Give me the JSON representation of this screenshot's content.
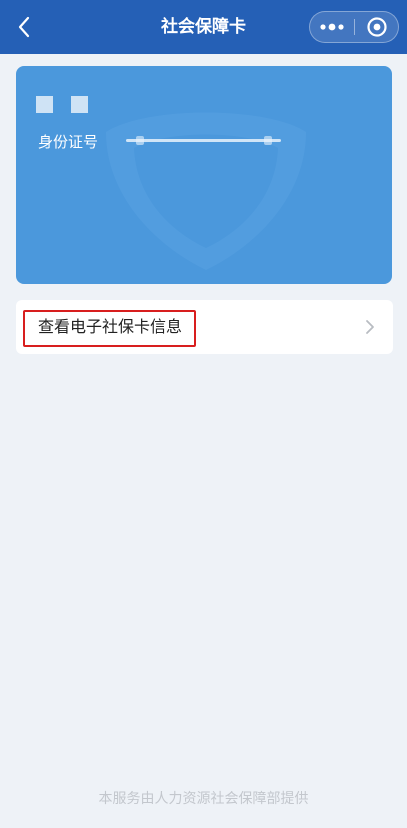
{
  "nav": {
    "title": "社会保障卡",
    "back_icon": "chevron-left-icon",
    "more_icon": "more-dots-icon",
    "close_icon": "target-close-icon",
    "background": "#2560b6"
  },
  "card": {
    "background": "#4b98dc",
    "id_label": "身份证号",
    "watermark_icon": "shield-icon"
  },
  "info_row": {
    "label": "查看电子社保卡信息",
    "highlight_color": "#d81e1e",
    "chevron_icon": "chevron-right-icon"
  },
  "footer": {
    "text": "本服务由人力资源社会保障部提供"
  }
}
